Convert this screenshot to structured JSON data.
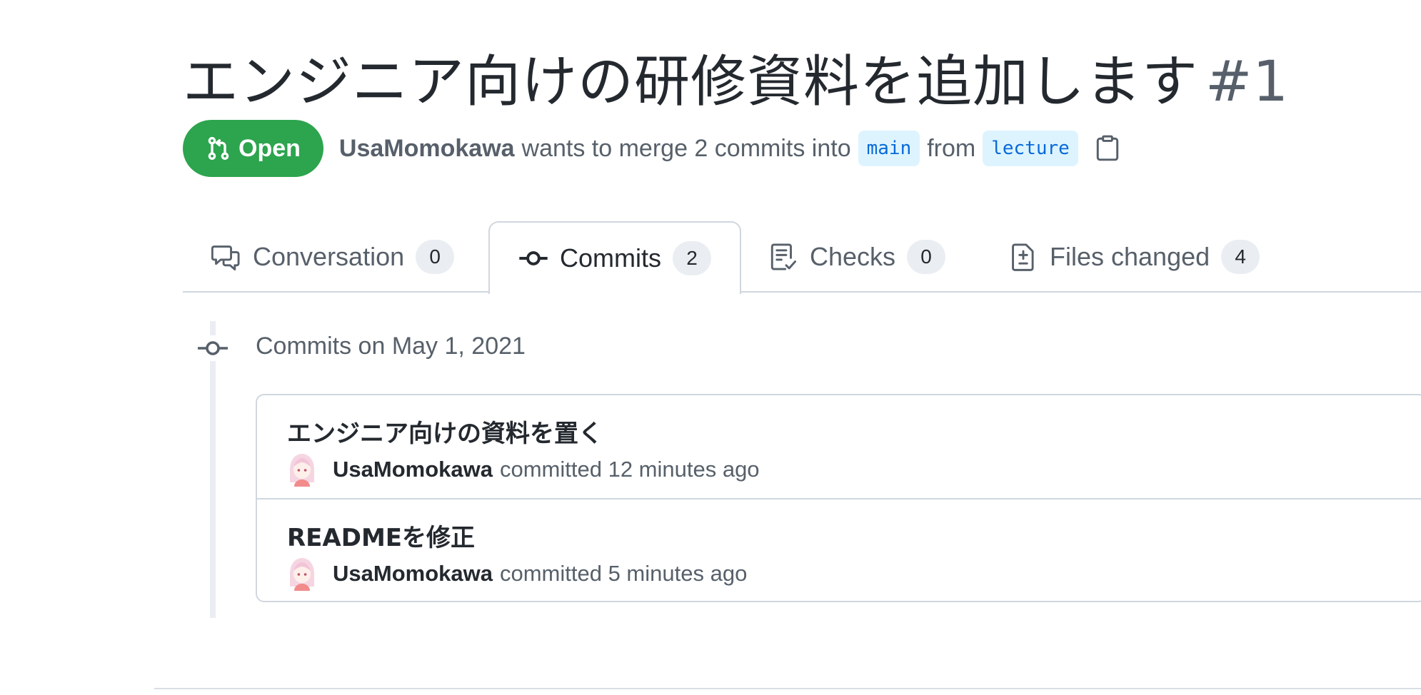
{
  "pull_request": {
    "title": "エンジニア向けの研修資料を追加します",
    "number": "#1",
    "state": "Open",
    "author": "UsaMomokawa",
    "summary_text": "wants to merge 2 commits into",
    "base_branch": "main",
    "from_text": "from",
    "head_branch": "lecture"
  },
  "tabs": [
    {
      "label": "Conversation",
      "count": "0",
      "icon": "comment-discussion-icon",
      "active": false
    },
    {
      "label": "Commits",
      "count": "2",
      "icon": "git-commit-icon",
      "active": true
    },
    {
      "label": "Checks",
      "count": "0",
      "icon": "checklist-icon",
      "active": false
    },
    {
      "label": "Files changed",
      "count": "4",
      "icon": "file-diff-icon",
      "active": false
    }
  ],
  "timeline": {
    "day_label": "Commits on May 1, 2021",
    "commits": [
      {
        "message": "エンジニア向けの資料を置く",
        "author": "UsaMomokawa",
        "action": "committed",
        "time": "12 minutes ago"
      },
      {
        "message": "READMEを修正",
        "author": "UsaMomokawa",
        "action": "committed",
        "time": "5 minutes ago"
      }
    ]
  },
  "colors": {
    "open_green": "#2da44e",
    "branch_blue": "#0969da",
    "branch_bg": "#ddf4ff",
    "muted_text": "#57606a",
    "border": "#d0d7de"
  }
}
